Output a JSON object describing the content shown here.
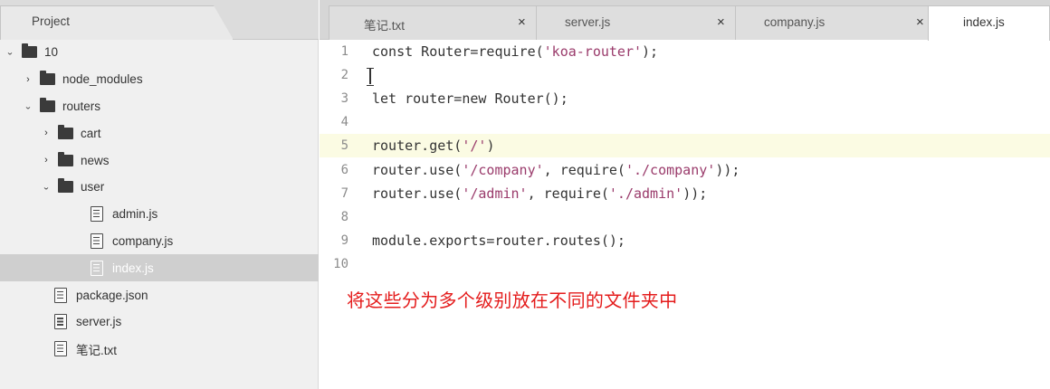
{
  "sidebar": {
    "title": "Project",
    "tree": [
      {
        "label": "10",
        "depth": 0,
        "type": "folder",
        "expanded": true
      },
      {
        "label": "node_modules",
        "depth": 1,
        "type": "folder",
        "expanded": false
      },
      {
        "label": "routers",
        "depth": 1,
        "type": "folder",
        "expanded": true
      },
      {
        "label": "cart",
        "depth": 2,
        "type": "folder",
        "expanded": false
      },
      {
        "label": "news",
        "depth": 2,
        "type": "folder",
        "expanded": false
      },
      {
        "label": "user",
        "depth": 2,
        "type": "folder",
        "expanded": true
      },
      {
        "label": "admin.js",
        "depth": 3,
        "type": "file"
      },
      {
        "label": "company.js",
        "depth": 3,
        "type": "file"
      },
      {
        "label": "index.js",
        "depth": 3,
        "type": "file",
        "selected": true
      },
      {
        "label": "package.json",
        "depth": 1,
        "type": "file"
      },
      {
        "label": "server.js",
        "depth": 1,
        "type": "file"
      },
      {
        "label": "笔记.txt",
        "depth": 1,
        "type": "file"
      }
    ]
  },
  "tabs": [
    {
      "label": "笔记.txt",
      "close": "×"
    },
    {
      "label": "server.js",
      "close": "×"
    },
    {
      "label": "company.js",
      "close": "×"
    },
    {
      "label": "index.js",
      "active": true
    }
  ],
  "editor": {
    "current_line": 5,
    "lines": [
      {
        "num": "1",
        "text": "const Router=require('koa-router');"
      },
      {
        "num": "2",
        "text": ""
      },
      {
        "num": "3",
        "text": "let router=new Router();"
      },
      {
        "num": "4",
        "text": ""
      },
      {
        "num": "5",
        "text": "router.get('/')"
      },
      {
        "num": "6",
        "text": "router.use('/company', require('./company'));"
      },
      {
        "num": "7",
        "text": "router.use('/admin', require('./admin'));"
      },
      {
        "num": "8",
        "text": ""
      },
      {
        "num": "9",
        "text": "module.exports=router.routes();"
      },
      {
        "num": "10",
        "text": ""
      }
    ]
  },
  "subtitle": "将这些分为多个级别放在不同的文件夹中",
  "icons": {
    "folder": "folder-icon",
    "file": "file-icon",
    "chevron_right": "›",
    "chevron_down": "⌄",
    "eol_marker": "¤¬"
  },
  "colors": {
    "current_line_bg": "#fbfbe3",
    "string": "#9a3b6b",
    "subtitle": "#e41c1c",
    "sidebar_bg": "#f0f0f0",
    "selected_row": "#cfcfcf"
  }
}
